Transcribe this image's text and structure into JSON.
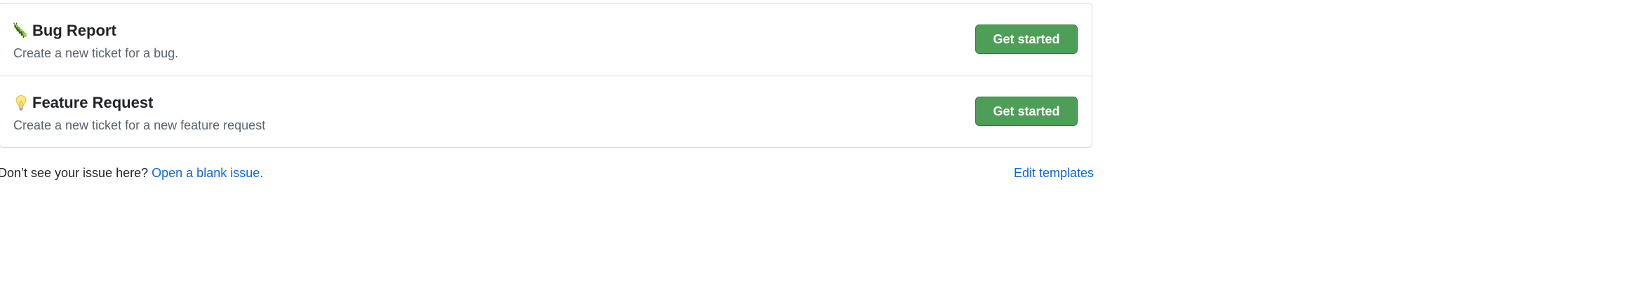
{
  "templates": [
    {
      "icon": "caterpillar-icon",
      "title": "Bug Report",
      "description": "Create a new ticket for a bug.",
      "button_label": "Get started"
    },
    {
      "icon": "light-bulb-icon",
      "title": "Feature Request",
      "description": "Create a new ticket for a new feature request",
      "button_label": "Get started"
    }
  ],
  "footer": {
    "prompt": "Don’t see your issue here?",
    "blank_issue_link": "Open a blank issue.",
    "edit_templates_link": "Edit templates"
  },
  "colors": {
    "button_green": "#4e9e57",
    "link_blue": "#0969da",
    "border": "#d0d7de"
  }
}
